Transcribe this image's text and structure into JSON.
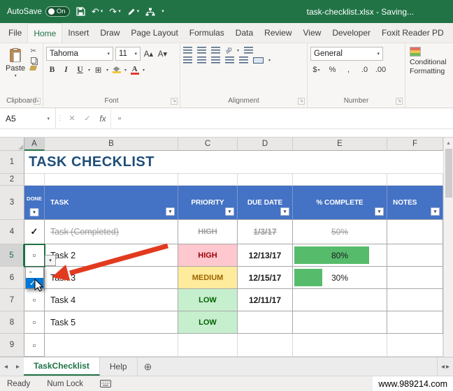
{
  "titlebar": {
    "autosave_label": "AutoSave",
    "autosave_state": "On",
    "title": "task-checklist.xlsx - Saving..."
  },
  "ribbon_tabs": [
    "File",
    "Home",
    "Insert",
    "Draw",
    "Page Layout",
    "Formulas",
    "Data",
    "Review",
    "View",
    "Developer",
    "Foxit Reader PD"
  ],
  "ribbon": {
    "paste_label": "Paste",
    "font_name": "Tahoma",
    "font_size": "11",
    "number_format": "General",
    "conditional_formatting_line1": "Conditional",
    "conditional_formatting_line2": "Formatting",
    "group_labels": {
      "clipboard": "Clipboard",
      "font": "Font",
      "alignment": "Alignment",
      "number": "Number"
    }
  },
  "formula_bar": {
    "name_box": "A5",
    "fx_label": "fx",
    "content": "▫"
  },
  "sheet": {
    "column_headers": [
      "A",
      "B",
      "C",
      "D",
      "E",
      "F"
    ],
    "row_headers": [
      "1",
      "2",
      "3",
      "4",
      "5",
      "6",
      "7",
      "8",
      "9"
    ],
    "title": "TASK CHECKLIST",
    "table_headers": [
      "DONE",
      "TASK",
      "PRIORITY",
      "DUE DATE",
      "% COMPLETE",
      "NOTES"
    ],
    "rows": [
      {
        "done": "✓",
        "task": "Task (Completed)",
        "priority": "HIGH",
        "due_date": "1/3/17",
        "complete": "50%"
      },
      {
        "done": "▫",
        "task": "Task 2",
        "priority": "HIGH",
        "due_date": "12/13/17",
        "complete": "80%"
      },
      {
        "done": "",
        "task": "Task 3",
        "priority": "MEDIUM",
        "due_date": "12/15/17",
        "complete": "30%"
      },
      {
        "done": "▫",
        "task": "Task 4",
        "priority": "LOW",
        "due_date": "12/11/17",
        "complete": ""
      },
      {
        "done": "▫",
        "task": "Task 5",
        "priority": "LOW",
        "due_date": "",
        "complete": ""
      },
      {
        "done": "▫",
        "task": "",
        "priority": "",
        "due_date": "",
        "complete": ""
      }
    ],
    "dropdown_options": [
      "▫",
      "✓"
    ]
  },
  "sheet_tabs": {
    "active_tab": "TaskChecklist",
    "help_tab": "Help"
  },
  "status_bar": {
    "mode": "Ready",
    "numlock": "Num Lock",
    "watermark": "www.989214.com"
  },
  "colors": {
    "excel_green": "#217346",
    "table_header_blue": "#4472C4",
    "title_blue": "#1F4E79",
    "priority_high_bg": "#FFC7CE",
    "priority_high_text": "#9C0006",
    "priority_medium_bg": "#FFEB9C",
    "priority_medium_text": "#9C6500",
    "priority_low_bg": "#C6EFCE",
    "priority_low_text": "#006100",
    "progress_green": "#57BB6C",
    "dropdown_selected_blue": "#0078D7",
    "arrow_red": "#E23A1F"
  },
  "icons": {
    "caret_down": "▾",
    "caret_up": "▴",
    "scroll_left": "◂",
    "scroll_right": "▸",
    "check": "✓",
    "cancel": "✕",
    "undo": "↶",
    "redo": "↷",
    "cut": "✂",
    "bold": "B",
    "italic": "I",
    "underline": "U",
    "borders_grid": "⊞",
    "dollar": "$",
    "percent": "%",
    "comma": ",",
    "decimal_inc": ".0",
    "decimal_dec": ".00",
    "add_sheet": "⊕",
    "dialog_launcher": "↘",
    "select_all_corner": "◢",
    "font_color_letter": "A",
    "grow_font": "A▴",
    "shrink_font": "A▾",
    "orientation": "ab",
    "vertical_dots": "⋮"
  }
}
